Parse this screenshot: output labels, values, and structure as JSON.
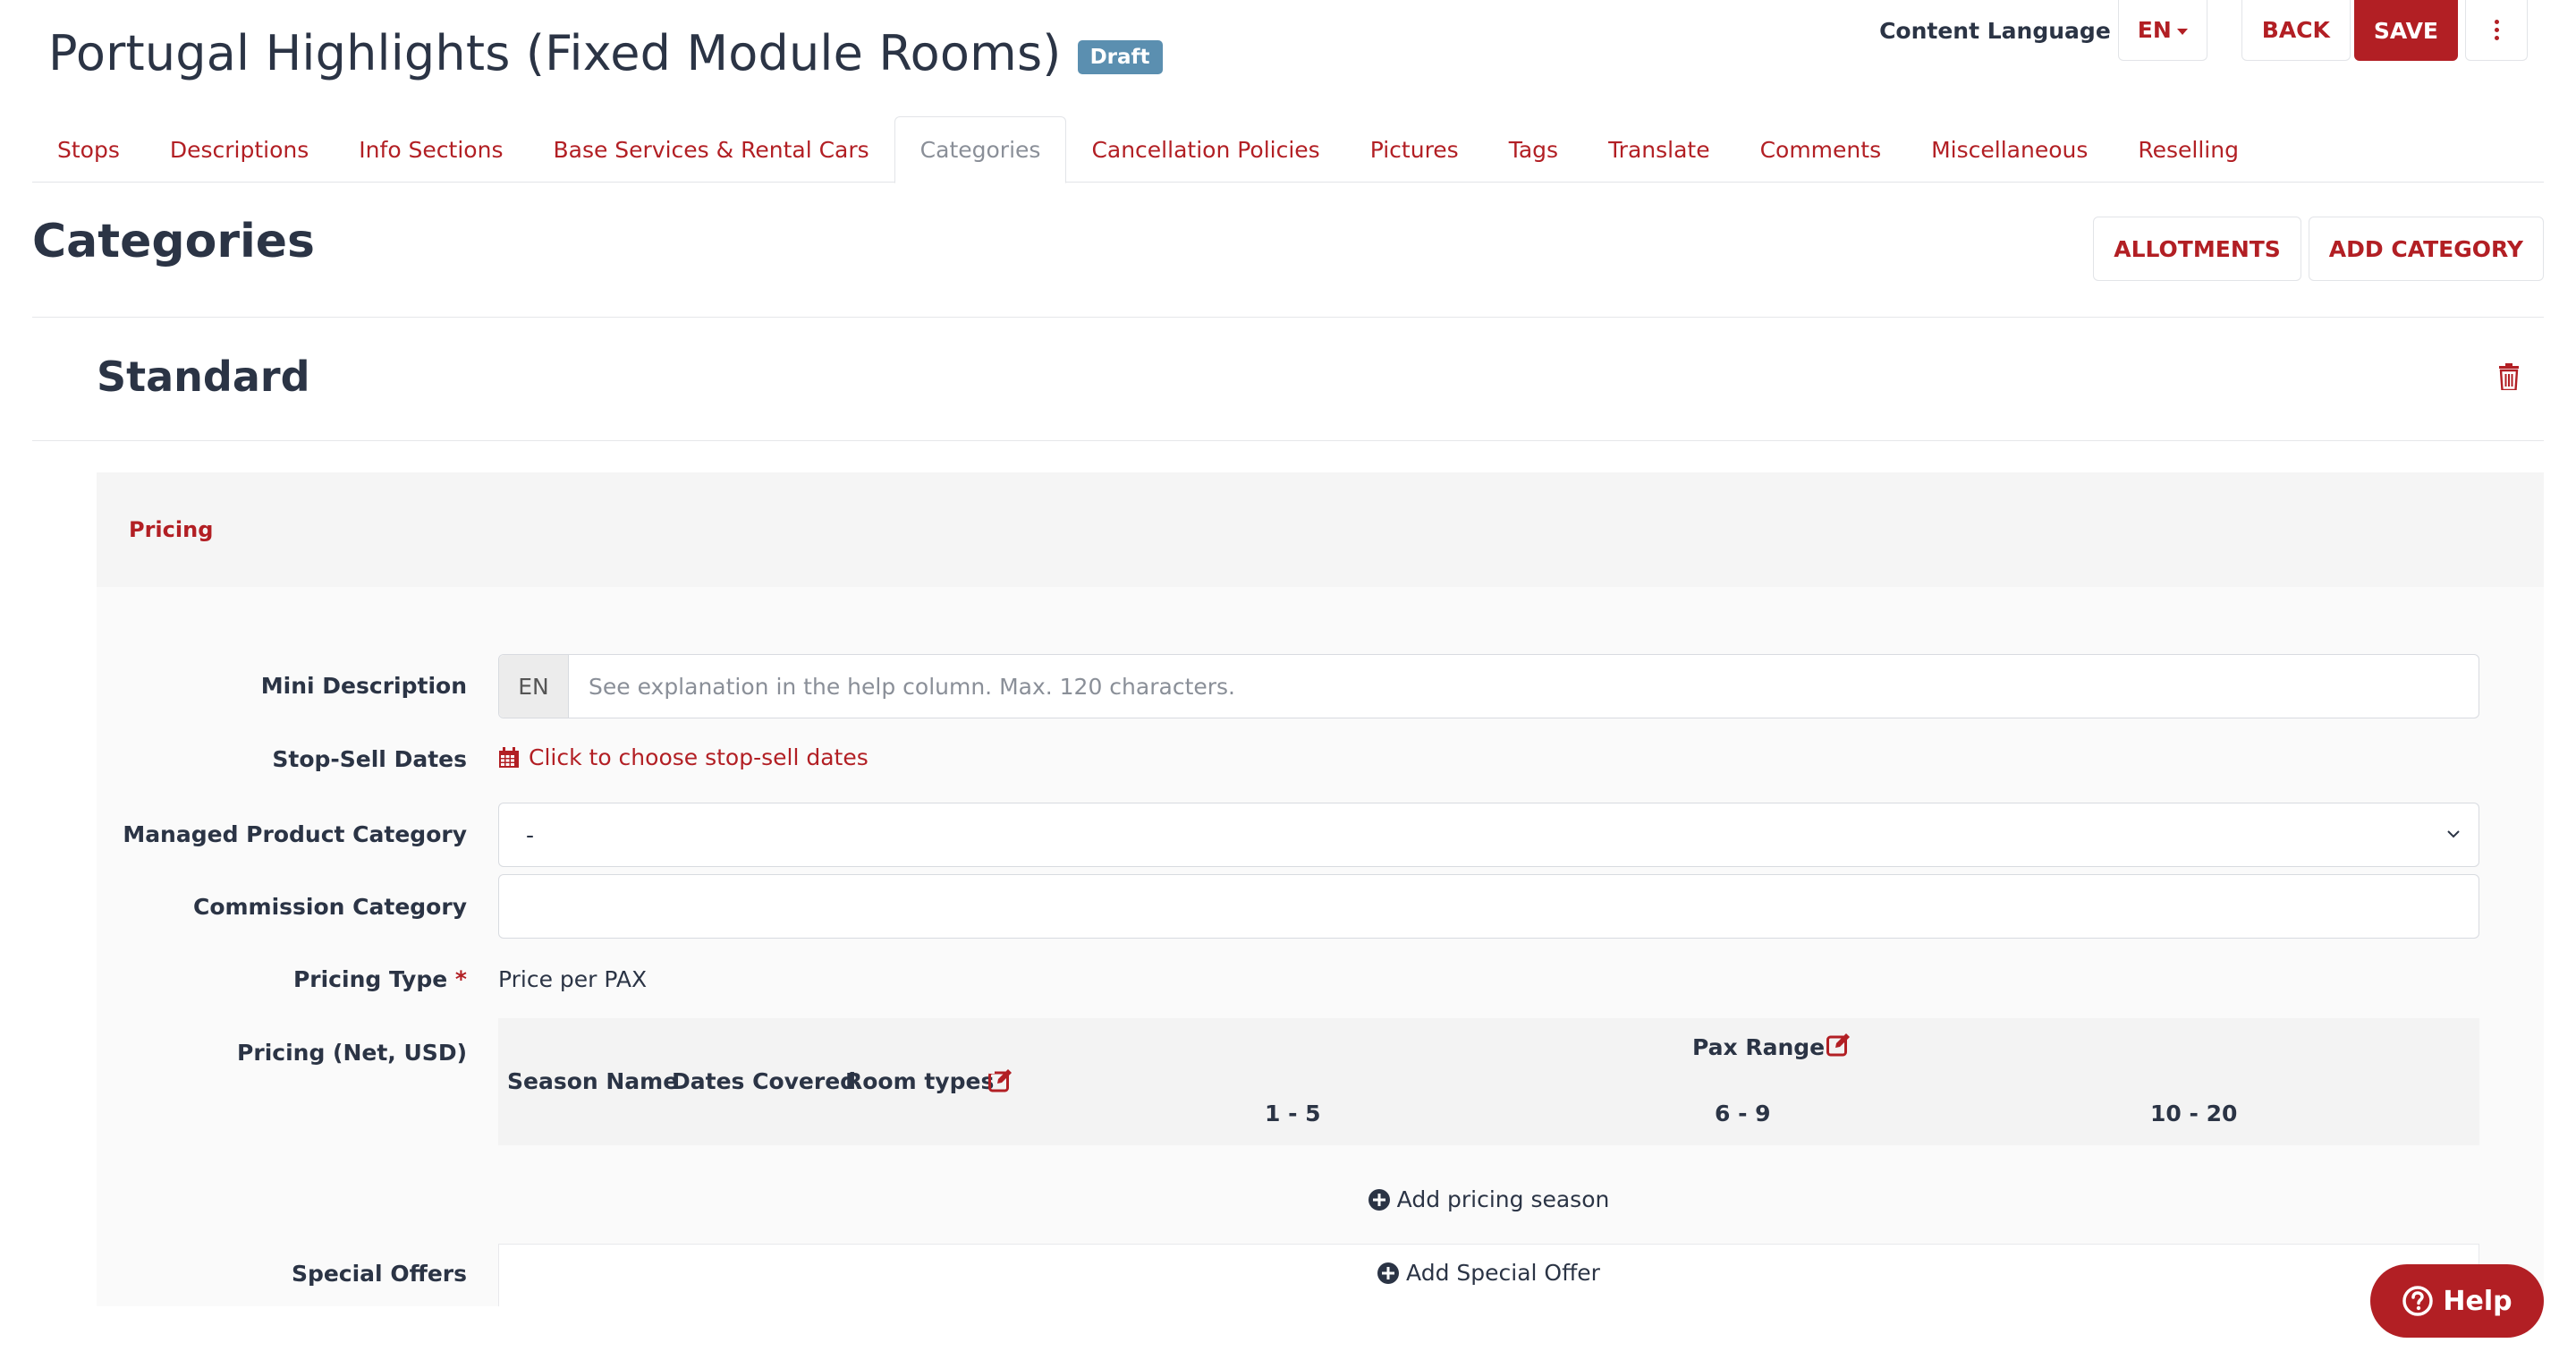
{
  "header": {
    "title": "Portugal Highlights (Fixed Module Rooms)",
    "status_badge": "Draft",
    "content_language_label": "Content Language",
    "language_value": "EN",
    "back_label": "BACK",
    "save_label": "SAVE"
  },
  "tabs": [
    {
      "label": "Stops"
    },
    {
      "label": "Descriptions"
    },
    {
      "label": "Info Sections"
    },
    {
      "label": "Base Services & Rental Cars"
    },
    {
      "label": "Categories",
      "active": true
    },
    {
      "label": "Cancellation Policies"
    },
    {
      "label": "Pictures"
    },
    {
      "label": "Tags"
    },
    {
      "label": "Translate"
    },
    {
      "label": "Comments"
    },
    {
      "label": "Miscellaneous"
    },
    {
      "label": "Reselling"
    }
  ],
  "section": {
    "title": "Categories",
    "allotments_label": "ALLOTMENTS",
    "add_category_label": "ADD CATEGORY"
  },
  "category": {
    "name": "Standard",
    "panel_label": "Pricing"
  },
  "form": {
    "mini_description": {
      "label": "Mini Description",
      "addon": "EN",
      "placeholder": "See explanation in the help column. Max. 120 characters."
    },
    "stop_sell": {
      "label": "Stop-Sell Dates",
      "link": "Click to choose stop-sell dates"
    },
    "managed_product_category": {
      "label": "Managed Product Category",
      "value": "-"
    },
    "commission_category": {
      "label": "Commission Category",
      "value": ""
    },
    "pricing_type": {
      "label": "Pricing Type",
      "required_mark": "*",
      "value": "Price per PAX"
    },
    "pricing_net": {
      "label": "Pricing (Net, USD)"
    },
    "special_offers": {
      "label": "Special Offers",
      "add_label": "Add Special Offer"
    }
  },
  "pricing_table": {
    "columns": [
      "Season Name",
      "Dates Covered",
      "Room types"
    ],
    "pax_range_label": "Pax Range",
    "pax_ranges": [
      "1 - 5",
      "6 - 9",
      "10 - 20"
    ],
    "add_season_label": "Add pricing season"
  },
  "help": {
    "label": "Help"
  },
  "colors": {
    "accent": "#b21f24",
    "badge": "#5b8fb0",
    "text": "#2b3445"
  }
}
